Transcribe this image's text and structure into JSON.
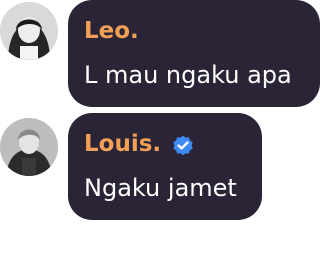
{
  "colors": {
    "bubble_bg": "#2a2436",
    "sender_name": "#f2a055",
    "message_text": "#ffffff",
    "verified_badge": "#3d8bf2"
  },
  "messages": [
    {
      "sender": "Leo.",
      "text": "L mau ngaku apa",
      "verified": false,
      "avatar": "avatar-icon"
    },
    {
      "sender": "Louis.",
      "text": "Ngaku jamet",
      "verified": true,
      "badge_icon": "verified-badge-icon",
      "avatar": "avatar-icon"
    }
  ]
}
